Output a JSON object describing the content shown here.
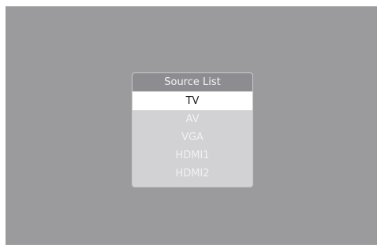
{
  "source_list": {
    "title": "Source List",
    "items": [
      {
        "label": "TV",
        "selected": true
      },
      {
        "label": "AV",
        "selected": false
      },
      {
        "label": "VGA",
        "selected": false
      },
      {
        "label": "HDMI1",
        "selected": false
      },
      {
        "label": "HDMI2",
        "selected": false
      }
    ]
  },
  "colors": {
    "screen_background": "#9b9b9e",
    "header_background": "#8d8d91",
    "list_background": "#d2d2d4",
    "selected_background": "#ffffff"
  }
}
